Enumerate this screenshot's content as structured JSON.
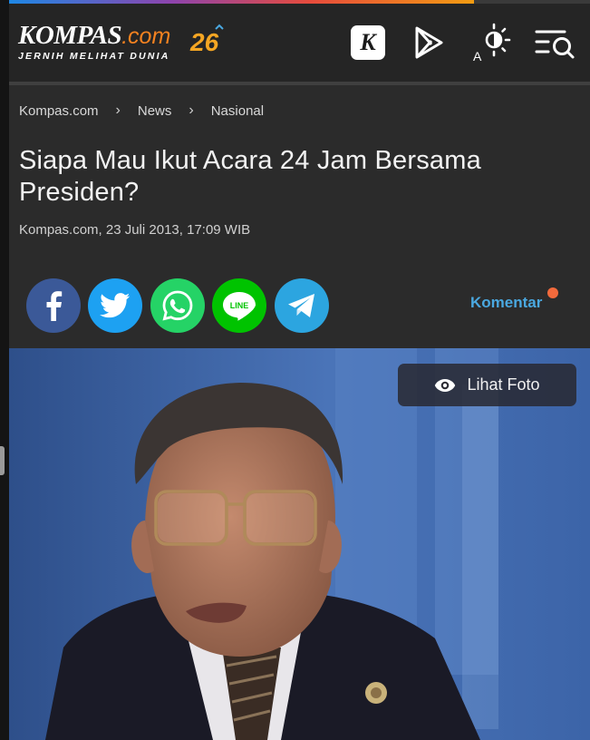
{
  "header": {
    "logo_text": "KOMPAS",
    "logo_domain": ".com",
    "logo_tagline": "JERNIH MELIHAT DUNIA",
    "logo_badge": "26",
    "icons": [
      "kompas-k-icon",
      "play-store-icon",
      "theme-toggle-icon",
      "menu-search-icon"
    ],
    "theme_toggle_letter": "A"
  },
  "breadcrumb": {
    "items": [
      "Kompas.com",
      "News",
      "Nasional"
    ],
    "separator": "›"
  },
  "article": {
    "title": "Siapa Mau Ikut Acara 24 Jam Bersama Presiden?",
    "meta": "Kompas.com, 23 Juli 2013, 17:09 WIB"
  },
  "share": {
    "buttons": [
      {
        "name": "facebook",
        "color": "#3b5998"
      },
      {
        "name": "twitter",
        "color": "#1da1f2"
      },
      {
        "name": "whatsapp",
        "color": "#25d366"
      },
      {
        "name": "line",
        "color": "#00c300"
      },
      {
        "name": "telegram",
        "color": "#2ca5e0"
      }
    ],
    "line_label": "LINE",
    "comment_label": "Komentar"
  },
  "photo": {
    "view_button_label": "Lihat Foto"
  },
  "colors": {
    "accent_orange": "#f58220",
    "comment_blue": "#4aa8e0",
    "notification_dot": "#f26a3c"
  }
}
